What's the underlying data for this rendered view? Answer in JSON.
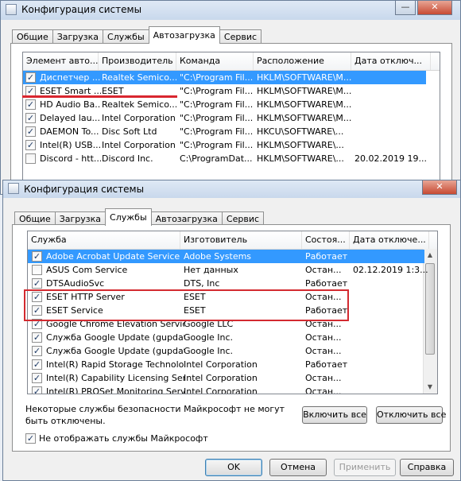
{
  "back_window": {
    "title": "Конфигурация системы",
    "tabs": [
      "Общие",
      "Загрузка",
      "Службы",
      "Автозагрузка",
      "Сервис"
    ],
    "active_tab": "Автозагрузка",
    "columns": [
      "Элемент авто...",
      "Производитель",
      "Команда",
      "Расположение",
      "Дата отключ..."
    ],
    "rows": [
      {
        "checked": true,
        "selected": true,
        "cells": [
          "Диспетчер ...",
          "Realtek Semico...",
          "\"C:\\Program Fil...",
          "HKLM\\SOFTWARE\\M...",
          ""
        ]
      },
      {
        "checked": true,
        "selected": false,
        "cells": [
          "ESET Smart ...",
          "ESET",
          "\"C:\\Program Fil...",
          "HKLM\\SOFTWARE\\M...",
          ""
        ]
      },
      {
        "checked": true,
        "selected": false,
        "cells": [
          "HD Audio Ba...",
          "Realtek Semico...",
          "\"C:\\Program Fil...",
          "HKLM\\SOFTWARE\\M...",
          ""
        ]
      },
      {
        "checked": true,
        "selected": false,
        "cells": [
          "Delayed lau...",
          "Intel Corporation",
          "\"C:\\Program Fil...",
          "HKLM\\SOFTWARE\\M...",
          ""
        ]
      },
      {
        "checked": true,
        "selected": false,
        "cells": [
          "DAEMON To...",
          "Disc Soft Ltd",
          "\"C:\\Program Fil...",
          "HKCU\\SOFTWARE\\...",
          ""
        ]
      },
      {
        "checked": true,
        "selected": false,
        "cells": [
          "Intel(R) USB...",
          "Intel Corporation",
          "\"C:\\Program Fil...",
          "HKLM\\SOFTWARE\\...",
          ""
        ]
      },
      {
        "checked": false,
        "selected": false,
        "cells": [
          "Discord - htt...",
          "Discord Inc.",
          "C:\\ProgramDat...",
          "HKLM\\SOFTWARE\\...",
          "20.02.2019 19..."
        ]
      }
    ]
  },
  "front_window": {
    "title": "Конфигурация системы",
    "tabs": [
      "Общие",
      "Загрузка",
      "Службы",
      "Автозагрузка",
      "Сервис"
    ],
    "active_tab": "Службы",
    "columns": [
      "Служба",
      "Изготовитель",
      "Состоя...",
      "Дата отключе..."
    ],
    "rows": [
      {
        "checked": true,
        "selected": true,
        "cells": [
          "Adobe Acrobat Update Service",
          "Adobe Systems",
          "Работает",
          ""
        ]
      },
      {
        "checked": false,
        "selected": false,
        "cells": [
          "ASUS Com Service",
          "Нет данных",
          "Остан...",
          "02.12.2019 1:3..."
        ]
      },
      {
        "checked": true,
        "selected": false,
        "cells": [
          "DTSAudioSvc",
          "DTS, Inc",
          "Работает",
          ""
        ]
      },
      {
        "checked": true,
        "selected": false,
        "cells": [
          "ESET HTTP Server",
          "ESET",
          "Остан...",
          ""
        ]
      },
      {
        "checked": true,
        "selected": false,
        "cells": [
          "ESET Service",
          "ESET",
          "Работает",
          ""
        ]
      },
      {
        "checked": true,
        "selected": false,
        "cells": [
          "Google Chrome Elevation Service",
          "Google LLC",
          "Остан...",
          ""
        ]
      },
      {
        "checked": true,
        "selected": false,
        "cells": [
          "Служба Google Update (gupdate)",
          "Google Inc.",
          "Остан...",
          ""
        ]
      },
      {
        "checked": true,
        "selected": false,
        "cells": [
          "Служба Google Update (gupdatem)",
          "Google Inc.",
          "Остан...",
          ""
        ]
      },
      {
        "checked": true,
        "selected": false,
        "cells": [
          "Intel(R) Rapid Storage Technology",
          "Intel Corporation",
          "Работает",
          ""
        ]
      },
      {
        "checked": true,
        "selected": false,
        "cells": [
          "Intel(R) Capability Licensing Service...",
          "Intel Corporation",
          "Остан...",
          ""
        ]
      },
      {
        "checked": true,
        "selected": false,
        "cells": [
          "Intel(R) PROSet Monitoring Service",
          "Intel Corporation",
          "Остан...",
          ""
        ]
      }
    ],
    "note": "Некоторые службы безопасности Майкрософт не могут быть отключены.",
    "enable_all": "Включить все",
    "disable_all": "Отключить все",
    "hide_ms_label": "Не отображать службы Майкрософт",
    "hide_ms_checked": true,
    "buttons": {
      "ok": "OK",
      "cancel": "Отмена",
      "apply": "Применить",
      "help": "Справка"
    }
  },
  "icons": {
    "minimize": "minimize-icon",
    "close": "close-icon",
    "check": "check-icon"
  },
  "colors": {
    "selection": "#3399ff",
    "highlight_red": "#d32a30"
  }
}
